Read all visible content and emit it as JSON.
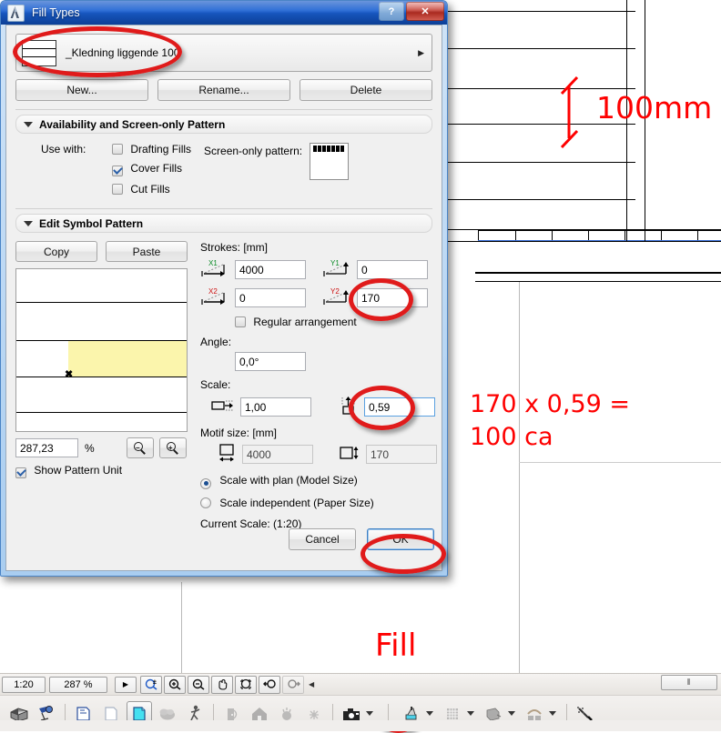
{
  "dialog": {
    "title": "Fill Types",
    "app_icon": "archicad-icon",
    "window_buttons": {
      "help": "?",
      "close": "✕"
    },
    "fill_selector": {
      "value": "_Kledning liggende  100",
      "arrow": "▶"
    },
    "buttons": {
      "new": "New...",
      "rename": "Rename...",
      "delete": "Delete"
    },
    "availability": {
      "header": "Availability and Screen-only Pattern",
      "use_with_label": "Use with:",
      "checkboxes": [
        {
          "label": "Drafting Fills",
          "checked": false
        },
        {
          "label": "Cover Fills",
          "checked": true
        },
        {
          "label": "Cut Fills",
          "checked": false
        }
      ],
      "screen_only_label": "Screen-only pattern:"
    },
    "edit_symbol": {
      "header": "Edit Symbol Pattern",
      "copy": "Copy",
      "paste": "Paste",
      "zoom_value": "287,23",
      "percent_sign": "%",
      "zoom_out_icon": "zoom-out-icon",
      "zoom_in_icon": "zoom-in-icon",
      "show_pattern_unit": {
        "label": "Show Pattern Unit",
        "checked": true
      },
      "strokes_label": "Strokes: [mm]",
      "strokes": [
        {
          "icon": "x1-icon",
          "tag": "X1",
          "color": "#0a8a25",
          "value": "4000"
        },
        {
          "icon": "y1-icon",
          "tag": "Y1",
          "color": "#0a8a25",
          "value": "0"
        },
        {
          "icon": "x2-icon",
          "tag": "X2",
          "color": "#cc1111",
          "value": "0"
        },
        {
          "icon": "y2-icon",
          "tag": "Y2",
          "color": "#cc1111",
          "value": "170"
        }
      ],
      "regular_arrangement": {
        "label": "Regular arrangement",
        "checked": false
      },
      "angle_label": "Angle:",
      "angle_value": "0,0°",
      "scale_label": "Scale:",
      "scale_x": {
        "icon": "scale-horizontal-icon",
        "value": "1,00"
      },
      "scale_y": {
        "icon": "scale-vertical-icon",
        "value": "0,59"
      },
      "motif_label": "Motif size: [mm]",
      "motif_w": {
        "icon": "width-icon",
        "value": "4000"
      },
      "motif_h": {
        "icon": "height-icon",
        "value": "170"
      },
      "radios": [
        {
          "label": "Scale with plan (Model Size)",
          "selected": true
        },
        {
          "label": "Scale independent (Paper Size)",
          "selected": false
        }
      ],
      "current_scale": "Current Scale: (1:20)"
    },
    "footer": {
      "cancel": "Cancel",
      "ok": "OK"
    }
  },
  "annotations": {
    "color": "#fe0000",
    "dimension_100mm": "100mm",
    "formula_line1": "170 x 0,59 =",
    "formula_line2": "100 ca",
    "fill_label": "Fill"
  },
  "statusbar": {
    "scale": "1:20",
    "zoom": "287 %",
    "next_arrow": "▶",
    "tools": [
      "zoom-plusminus-icon",
      "zoom-in-icon",
      "zoom-out-icon",
      "pan-hand-icon",
      "fit-window-icon",
      "zoom-previous-icon",
      "zoom-next-icon"
    ],
    "overflow_arrow": "◀",
    "scroll_grip": "⦀"
  },
  "toolbar": {
    "items": [
      "3d-block-icon",
      "3d-camera-icon",
      "sep",
      "copy-layer-icon",
      "blank-layer-icon",
      "active-layer-icon",
      "cloud-icon",
      "walk-figure-icon",
      "sep",
      "door-icon",
      "house-icon",
      "sun-object-icon",
      "sparkle-object-icon",
      "sep",
      "camera-icon",
      "caret",
      "sep2",
      "paint-bucket-icon",
      "caret",
      "hatch-icon",
      "caret",
      "solid-fill-icon",
      "caret",
      "gradient-fill-icon",
      "caret",
      "sep",
      "magic-wand-icon"
    ]
  }
}
